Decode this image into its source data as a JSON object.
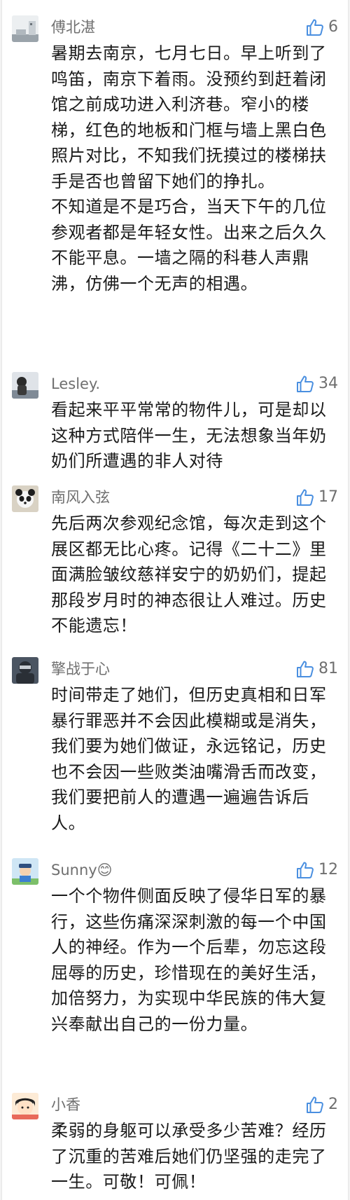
{
  "comments": [
    {
      "user": "傅北湛",
      "likes": "6",
      "paragraphs": [
        "暑期去南京，七月七日。早上听到了鸣笛，南京下着雨。没预约到赶着闭馆之前成功进入利济巷。窄小的楼梯，红色的地板和门框与墙上黑白色照片对比，不知我们抚摸过的楼梯扶手是否也曾留下她们的挣扎。",
        "不知道是不是巧合，当天下午的几位参观者都是年轻女性。出来之后久久不能平息。一墙之隔的科巷人声鼎沸，仿佛一个无声的相遇。"
      ]
    },
    {
      "user": "Lesley.",
      "likes": "34",
      "paragraphs": [
        "看起来平平常常的物件儿，可是却以这种方式陪伴一生，无法想象当年奶奶们所遭遇的非人对待"
      ]
    },
    {
      "user": "南风入弦",
      "likes": "17",
      "paragraphs": [
        "先后两次参观纪念馆，每次走到这个展区都无比心疼。记得《二十二》里面满脸皱纹慈祥安宁的奶奶们，提起那段岁月时的神态很让人难过。历史不能遗忘！"
      ]
    },
    {
      "user": "擎战于心",
      "likes": "81",
      "paragraphs": [
        "时间带走了她们，但历史真相和日军暴行罪恶并不会因此模糊或是消失，我们要为她们做证，永远铭记，历史也不会因一些败类油嘴滑舌而改变，我们要把前人的遭遇一遍遍告诉后人。"
      ]
    },
    {
      "user": "Sunny😊",
      "likes": "12",
      "paragraphs": [
        "一个个物件侧面反映了侵华日军的暴行，这些伤痛深深刺激的每一个中国人的神经。作为一个后辈，勿忘这段屈辱的历史，珍惜现在的美好生活，加倍努力，为实现中华民族的伟大复兴奉献出自己的一份力量。"
      ]
    },
    {
      "user": "小香",
      "likes": "2",
      "paragraphs": [
        "柔弱的身躯可以承受多少苦难？经历了沉重的苦难后她们仍坚强的走完了一生。可敬！可佩！"
      ]
    }
  ],
  "colors": {
    "accent": "#4a8fe0",
    "meta_text": "#6f6f6f",
    "body_text": "#1a1a1a"
  },
  "icons": {
    "like": "thumbs-up-outline-icon"
  }
}
